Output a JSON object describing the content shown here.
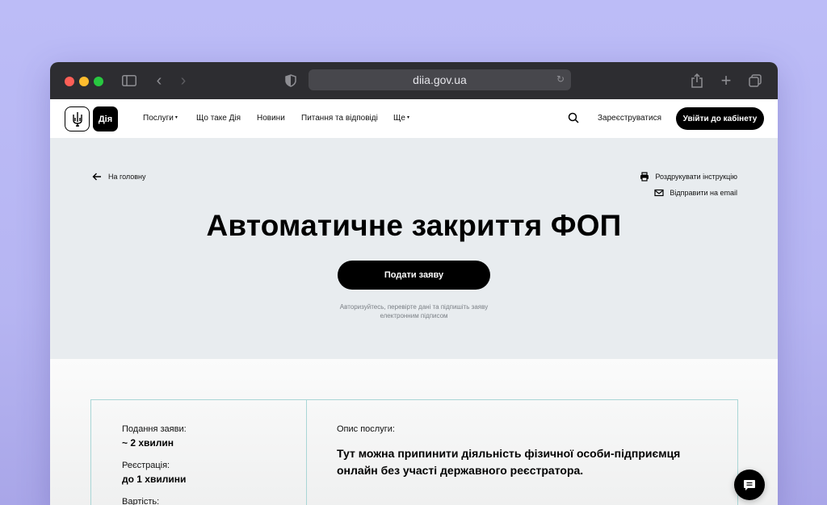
{
  "browser": {
    "url": "diia.gov.ua",
    "icons": [
      "sidebar-icon",
      "back-icon",
      "forward-icon",
      "shield-icon",
      "reload-icon",
      "share-icon",
      "new-tab-icon",
      "tabs-overview-icon"
    ]
  },
  "navbar": {
    "logo_text": "Дія",
    "items": [
      {
        "label": "Послуги",
        "caret": "▾"
      },
      {
        "label": "Що таке Дія"
      },
      {
        "label": "Новини"
      },
      {
        "label": "Питання та відповіді"
      },
      {
        "label": "Ще",
        "caret": "▾"
      }
    ],
    "register_label": "Зареєструватися",
    "login_label": "Увійти до кабінету"
  },
  "hero": {
    "back_label": "На головну",
    "print_label": "Роздрукувати інструкцію",
    "email_label": "Відправити на email",
    "title": "Автоматичне закриття ФОП",
    "apply_label": "Подати заяву",
    "note": "Авторизуйтесь, перевірте дані та підпишіть заяву електронним підписом"
  },
  "details": {
    "meta": [
      {
        "label": "Подання заяви:",
        "value": "~ 2 хвилин"
      },
      {
        "label": "Реєстрація:",
        "value": "до 1 хвилини"
      },
      {
        "label": "Вартість:",
        "value": ""
      }
    ],
    "description_label": "Опис послуги:",
    "description": "Тут можна припинити діяльність фізичної особи-підприємця онлайн без участі державного реєстратора."
  },
  "colors": {
    "background": "#bcbcf7",
    "titlebar": "#2d2d31",
    "hero_bg": "#e8ecef",
    "accent": "#000000",
    "card_border": "#a9d6d6"
  }
}
